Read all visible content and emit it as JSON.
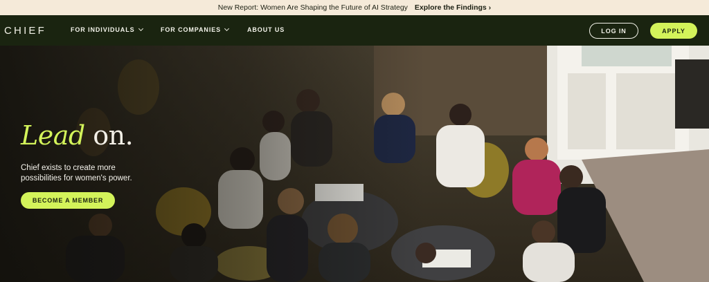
{
  "announcement": {
    "text": "New Report: Women Are Shaping the Future of AI Strategy",
    "cta": "Explore the Findings ›"
  },
  "nav": {
    "logo": "CHIEF",
    "items": [
      {
        "label": "FOR INDIVIDUALS"
      },
      {
        "label": "FOR COMPANIES"
      },
      {
        "label": "ABOUT US"
      }
    ],
    "login": "LOG IN",
    "apply": "APPLY"
  },
  "hero": {
    "headline_em": "Lead",
    "headline_rest": " on.",
    "subcopy": "Chief exists to create more possibilities for women's power.",
    "cta": "BECOME A MEMBER",
    "image": "Photo of women seated around small tables in a discussion circle"
  },
  "colors": {
    "accent": "#d3f35a",
    "nav_bg": "#1a2410",
    "banner_bg": "#f5ead9"
  }
}
